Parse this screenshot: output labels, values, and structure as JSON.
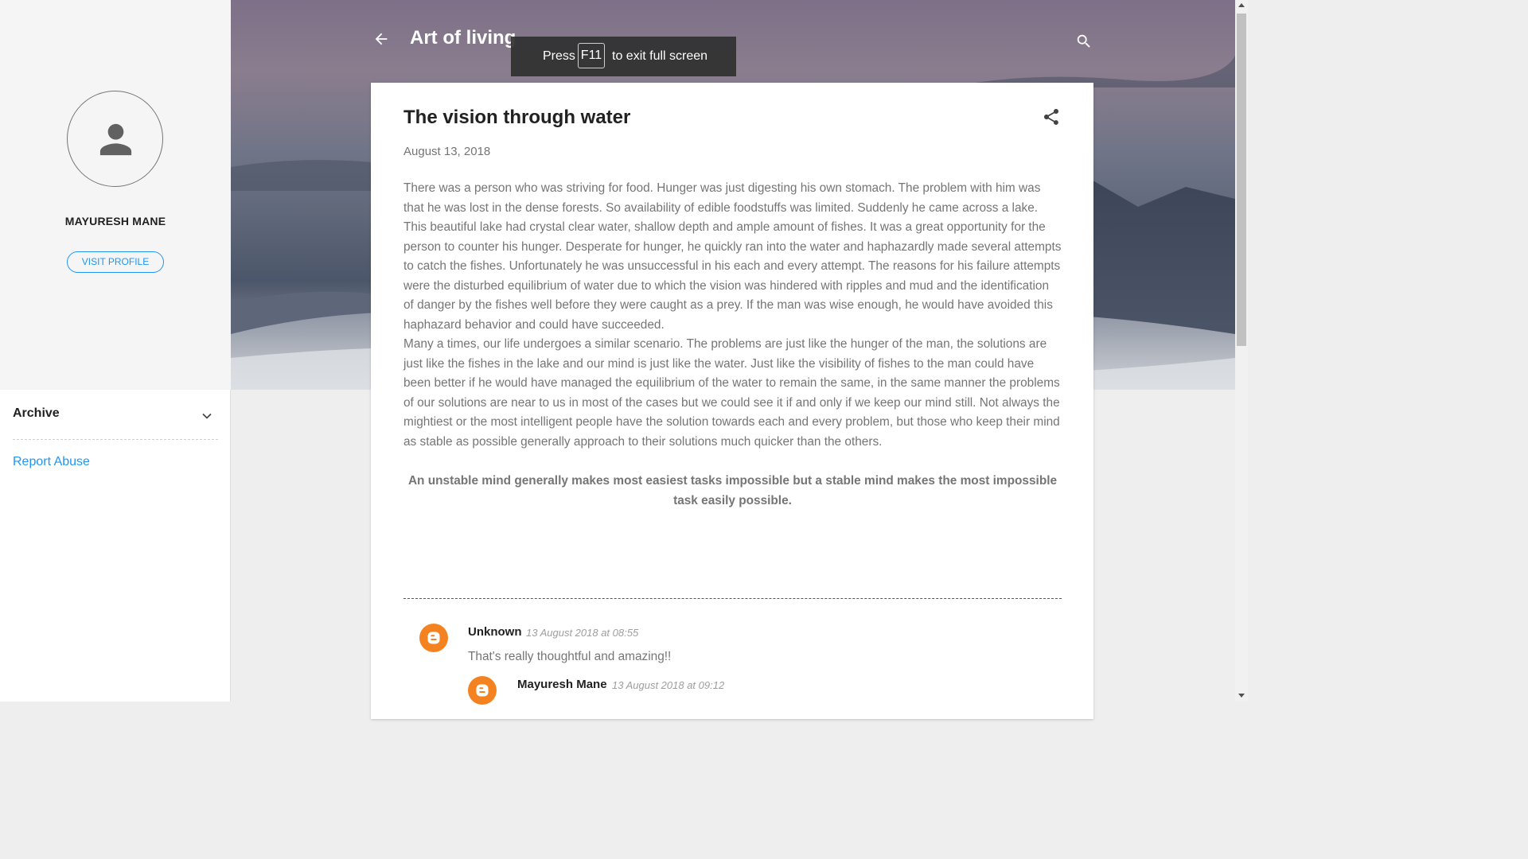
{
  "sidebar": {
    "profile_name": "MAYURESH MANE",
    "visit_profile_label": "VISIT PROFILE",
    "archive_label": "Archive",
    "report_abuse_label": "Report Abuse"
  },
  "header": {
    "blog_title": "Art of living"
  },
  "fullscreen_notice": {
    "prefix": "Press",
    "key": "F11",
    "suffix": "to exit full screen"
  },
  "post": {
    "title": "The vision through water",
    "date": "August 13, 2018",
    "paragraphs": [
      "There was a person who was striving for food. Hunger was just digesting his own stomach. The problem with him was that he was lost in the dense forests. So availability of edible foodstuffs was limited. Suddenly he came across a lake. This beautiful lake had crystal clear water, shallow depth and ample amount of fishes. It was a great opportunity for the person to counter his hunger. Desperate for hunger, he quickly ran into the water and haphazardly made several attempts to catch the fishes. Unfortunately he was unsuccessful in his each and every attempt. The reasons for his failure attempts were the disturbed equilibrium of water due to which the vision was hindered with ripples and mud and the identification of danger by the fishes well before they were caught as a prey. If the man was wise enough, he would have avoided this haphazard behavior and could have succeeded.",
      "Many a times, our life undergoes a similar scenario. The problems are just like the hunger of the man, the solutions are just like the fishes in the lake and our mind is just like the water. Just like the visibility of fishes to the man could have been better if he would have managed the equilibrium of the water to remain the same, in the same manner the problems of our solutions are near to us in most of the cases but we could see it if and only if we keep our mind still. Not always the mightiest or the most intelligent people have the solution towards each and every problem, but those who keep their mind as stable as possible generally approach to their solutions much quicker than the others."
    ],
    "quote": "An unstable mind generally makes most easiest tasks impossible but a stable mind makes the most impossible task easily possible."
  },
  "comments": [
    {
      "author": "Unknown",
      "timestamp": "13 August 2018 at 08:55",
      "text": "That's really thoughtful and amazing!!"
    },
    {
      "author": "Mayuresh Mane",
      "timestamp": "13 August 2018 at 09:12"
    }
  ],
  "icons": {
    "back": "arrow-back-icon",
    "search": "search-icon",
    "share": "share-icon",
    "archive_toggle": "chevron-down-icon",
    "avatar": "person-icon",
    "comment_avatar": "blogger-logo-icon"
  },
  "colors": {
    "accent": "#2196f3",
    "blogger_orange": "#f58220",
    "body_text": "#757575",
    "title_text": "#212121"
  }
}
